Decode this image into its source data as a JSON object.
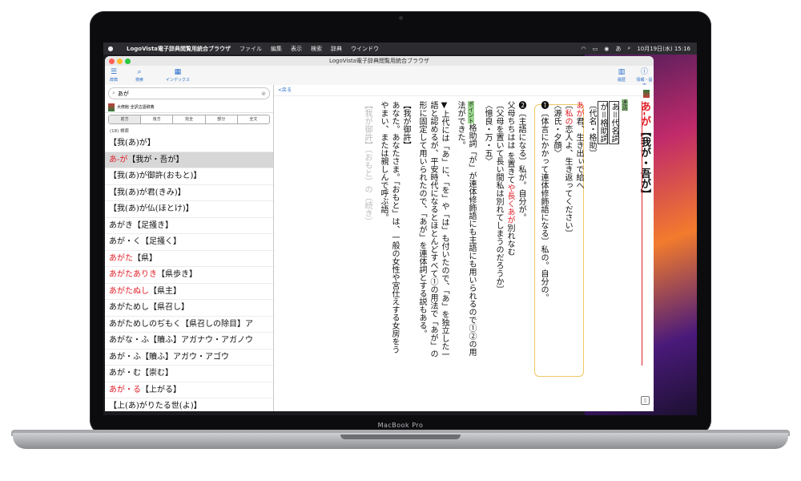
{
  "menubar": {
    "apple_icon": "",
    "items": [
      "LogoVista電子辞典閲覧用統合ブラウザ",
      "ファイル",
      "編集",
      "表示",
      "検索",
      "辞典",
      "ウインドウ"
    ],
    "clock": "10月19日(水) 15:16",
    "status_glyph": "あ"
  },
  "window": {
    "title": "LogoVista電子辞典閲覧用統合ブラウザ"
  },
  "toolbar": {
    "left": [
      {
        "label": "辞典",
        "icon": "list-icon"
      },
      {
        "label": "検索",
        "icon": "search-icon"
      },
      {
        "label": "インデックス",
        "icon": "grid-icon"
      }
    ],
    "right": [
      {
        "label": "履歴",
        "icon": "history-icon"
      },
      {
        "label": "情報・設定",
        "icon": "info-icon"
      }
    ]
  },
  "search": {
    "value": "あが",
    "icon": "search-icon"
  },
  "dictionary": {
    "name": "大修館 全訳古語辞典"
  },
  "search_modes": [
    "前方",
    "後方",
    "完全",
    "部分",
    "全文"
  ],
  "active_mode": "前方",
  "result_count": "(18) 検索",
  "results": [
    {
      "pre": "",
      "red": "",
      "post": "【我(あ)が】",
      "selected": false
    },
    {
      "pre": "",
      "red": "あ‐が",
      "post": "【我が・吾が】",
      "selected": true
    },
    {
      "pre": "",
      "red": "",
      "post": "【我(あ)が御許(おもと)】",
      "selected": false
    },
    {
      "pre": "",
      "red": "",
      "post": "【我(あ)が君(きみ)】",
      "selected": false
    },
    {
      "pre": "",
      "red": "",
      "post": "【我(あ)が仏(ほとけ)】",
      "selected": false
    },
    {
      "pre": "",
      "red": "",
      "post": "あがき【足掻き】",
      "selected": false
    },
    {
      "pre": "",
      "red": "",
      "post": "あが・く【足掻く】",
      "selected": false
    },
    {
      "pre": "",
      "red": "あがた",
      "post": "【県】",
      "selected": false
    },
    {
      "pre": "",
      "red": "あがたありき",
      "post": "【県歩き】",
      "selected": false
    },
    {
      "pre": "",
      "red": "あがたぬし",
      "post": "【県主】",
      "selected": false
    },
    {
      "pre": "",
      "red": "",
      "post": "あがためし【県召し】",
      "selected": false
    },
    {
      "pre": "",
      "red": "",
      "post": "あがためしのぢもく【県召しの除目】ア",
      "selected": false
    },
    {
      "pre": "",
      "red": "",
      "post": "あがな・ふ【贖ふ】アガナウ・アガノウ",
      "selected": false
    },
    {
      "pre": "",
      "red": "",
      "post": "あが・ふ【贖ふ】アガウ・アゴウ",
      "selected": false
    },
    {
      "pre": "",
      "red": "",
      "post": "あが・む【崇む】",
      "selected": false
    },
    {
      "pre": "",
      "red": "あが・る",
      "post": "【上がる】",
      "selected": false
    },
    {
      "pre": "",
      "red": "",
      "post": "【上(あ)がりたる世(よ)】",
      "selected": false
    },
    {
      "pre": "",
      "red": "",
      "post": "【上(あ)がりての世(よ)】",
      "selected": false
    }
  ],
  "article": {
    "back_label": "<戻る",
    "headword_red": "あ‐が",
    "headword_black": "【我が・吾が】",
    "category": "連語",
    "pos_line": "あ＝代名詞",
    "pos_line2": "が＝格助詞",
    "pos_bracket": "〔代名・格助〕",
    "sense1_text": "❶〔体言にかかって連体修飾語になる〕私の。自分の。",
    "sense1_ex_red": "あが",
    "sense1_ex": "君、生き出ぃで給へ",
    "sense1_tr_red": "私の",
    "sense1_tr": "恋人よ、生き返ってください",
    "sense1_src": "〈源氏・夕顔〉",
    "sense2_text": "❷〔主語になる〕私が。自分が。",
    "sense2_ex": "父母ちちはは を置きて",
    "sense2_ex_red": "や長くあが",
    "sense2_ex_end": "別れなむ",
    "sense2_tr": "〔父母を置いて長い間私は別れてしまうのだろうか〕",
    "sense2_src": "〈憶良・万・五〉",
    "point_label": "ポイント",
    "point_text1": "格助詞「が」が連体修飾語にも主語にも用いられるので①②の用",
    "point_text2": "法ができた。",
    "note1": "▼上代には「あ」に、「を」や「は」も付いたので、「あ」を独立した一",
    "note2": "語と認めるが、平安時代になるとほとんどすべて①の用法で「あが」の",
    "note3": "形に固定して用いられたので、「あが」を連体詞とする説もある。",
    "sub1": "【我が御許】",
    "sub1b": "あなた。あなたさま。「おもと」は、一般の女性や宮仕えする女房をう",
    "sub1c": "やまい、または親しんで呼ぶ語。",
    "sub2": "【我が御許】（おもと）の（続き）"
  },
  "laptop_label": "MacBook Pro"
}
